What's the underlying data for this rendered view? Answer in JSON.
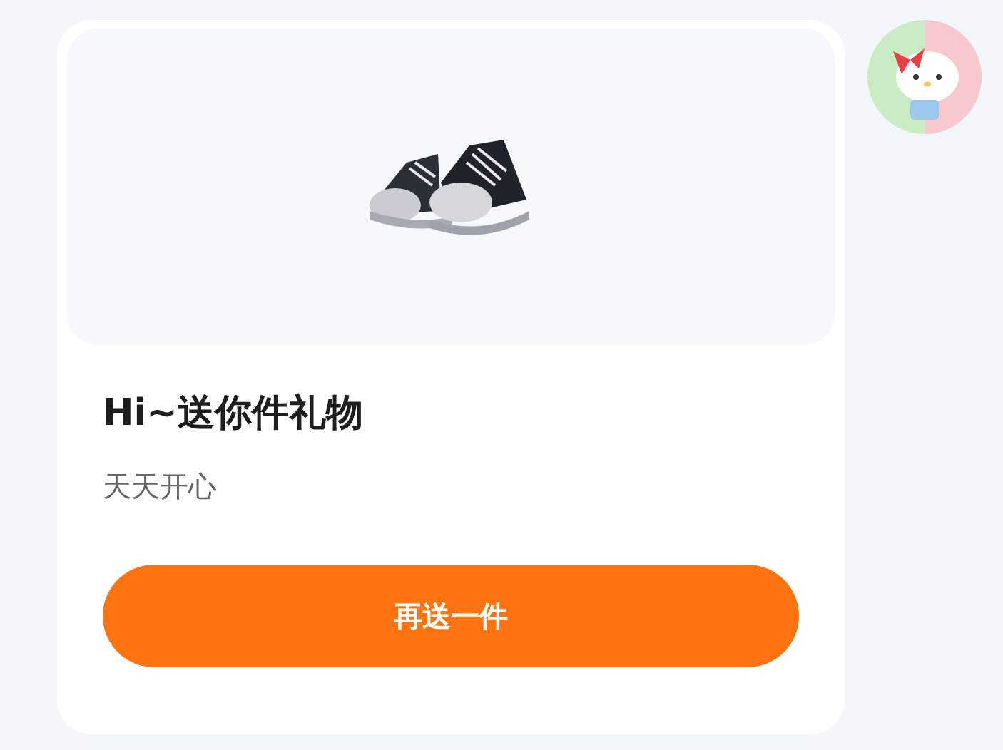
{
  "gift": {
    "title": "Hi~送你件礼物",
    "subtitle": "天天开心"
  },
  "button": {
    "label": "再送一件"
  }
}
